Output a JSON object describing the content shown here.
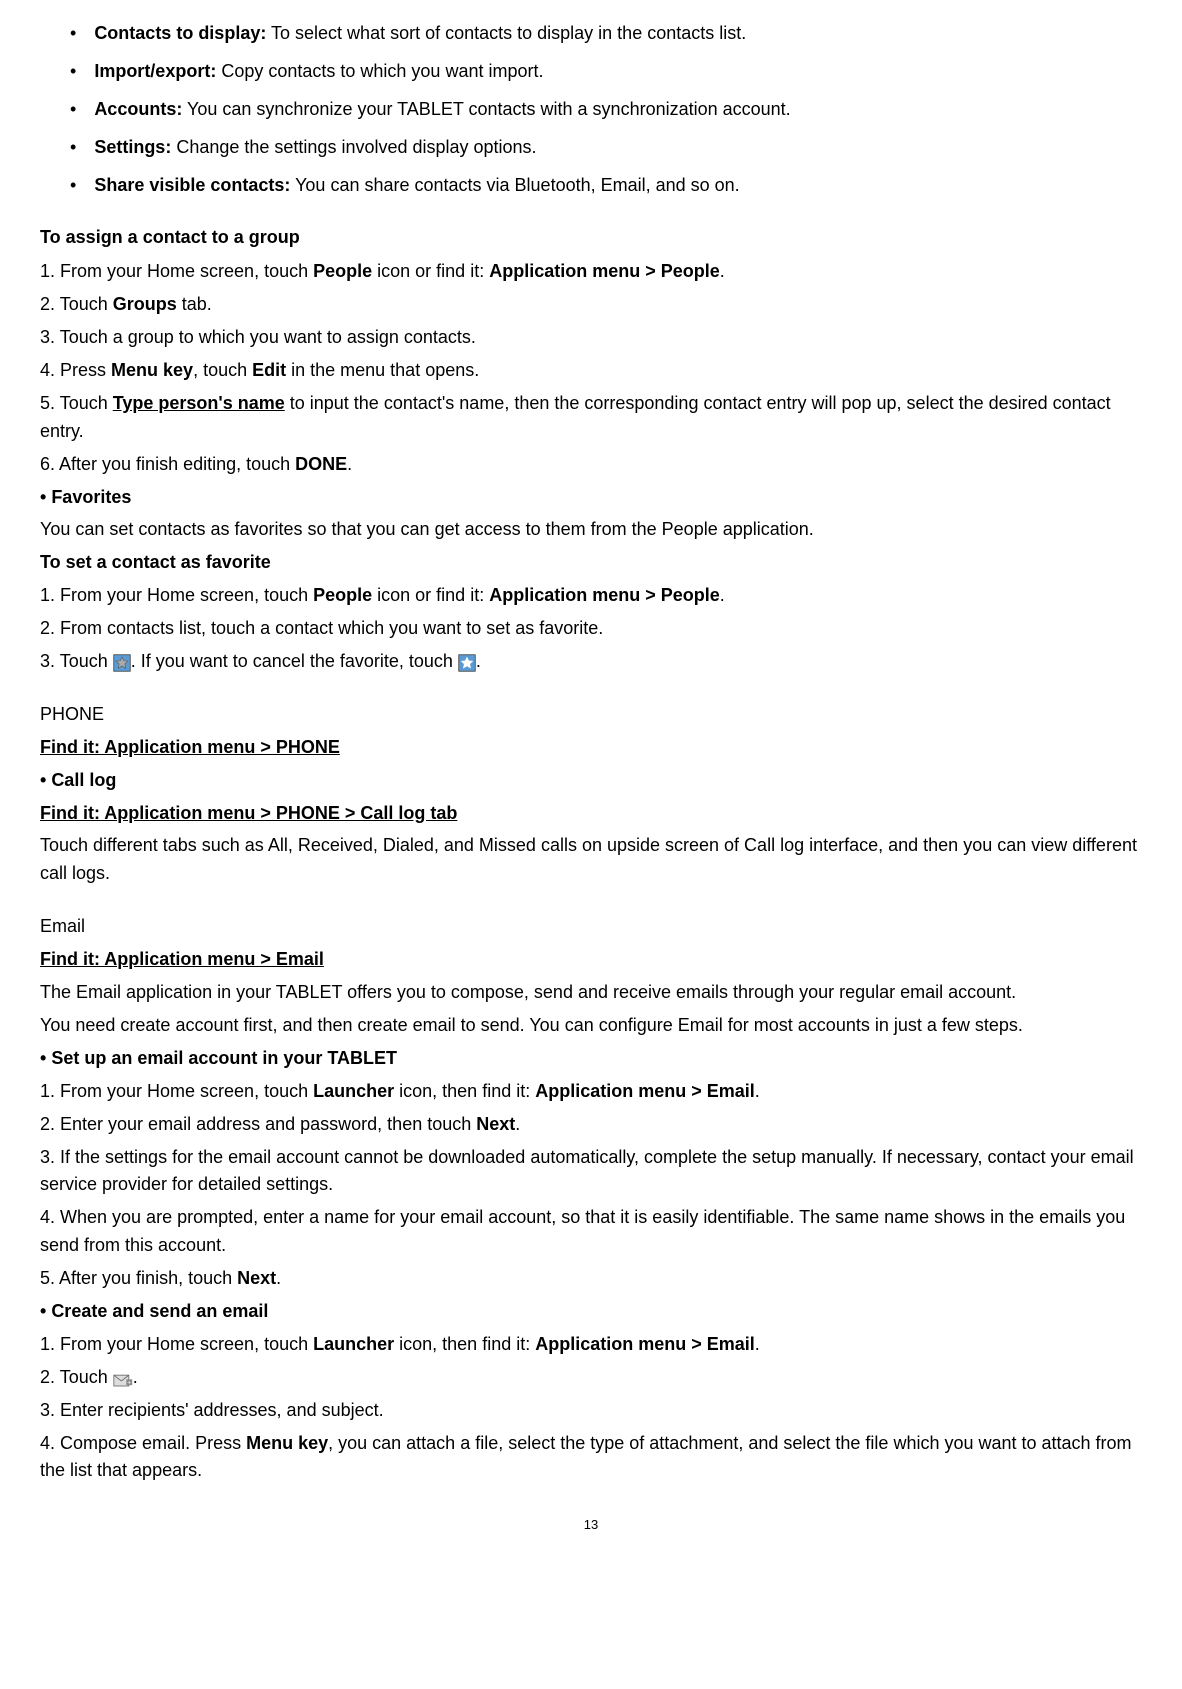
{
  "bullets": [
    {
      "label": "Contacts to display:",
      "text": " To select what sort of contacts to display in the contacts list."
    },
    {
      "label": "Import/export:",
      "text": " Copy contacts to which you want import."
    },
    {
      "label": "Accounts:",
      "text": " You can synchronize your TABLET contacts with a synchronization account."
    },
    {
      "label": "Settings:",
      "text": " Change the settings involved display options."
    },
    {
      "label": "Share visible contacts:",
      "text": " You can share contacts via Bluetooth, Email, and so on."
    }
  ],
  "assignGroup": {
    "heading": "To assign a contact to a group",
    "step1_a": "1. From your Home screen, touch ",
    "step1_b": "People",
    "step1_c": " icon or find it: ",
    "step1_d": "Application menu > People",
    "step1_e": ".",
    "step2_a": "2. Touch ",
    "step2_b": "Groups",
    "step2_c": " tab.",
    "step3": "3. Touch a group to which you want to assign contacts.",
    "step4_a": "4. Press ",
    "step4_b": "Menu key",
    "step4_c": ", touch ",
    "step4_d": "Edit",
    "step4_e": " in the menu that opens.",
    "step5_a": "5. Touch ",
    "step5_b": "Type person's name",
    "step5_c": " to input the contact's name, then the corresponding contact entry will pop up, select the desired contact entry.",
    "step6_a": "6. After you finish editing, touch ",
    "step6_b": "DONE",
    "step6_c": "."
  },
  "favorites": {
    "heading": "Favorites",
    "desc": "You can set contacts as favorites so that you can get access to them from the People application.",
    "subheading": "To set a contact as favorite",
    "step1_a": "1. From your Home screen, touch ",
    "step1_b": "People",
    "step1_c": " icon or find it: ",
    "step1_d": "Application menu > People",
    "step1_e": ".",
    "step2": "2. From contacts list, touch a contact which you want to set as favorite.",
    "step3_a": "3. Touch ",
    "step3_b": ". If you want to cancel the favorite, touch ",
    "step3_c": "."
  },
  "phone": {
    "heading": "PHONE",
    "findit": "Find it: Application menu > PHONE",
    "calllog": "Call log",
    "findit2": "Find it: Application menu > PHONE > Call log tab",
    "desc": "Touch different tabs such as All, Received, Dialed, and Missed calls on upside screen of Call log interface, and then you can view different call logs."
  },
  "email": {
    "heading": "Email",
    "findit": "Find it: Application menu > Email",
    "desc1": "The Email application in your TABLET offers you to compose, send and receive emails through your regular email account.",
    "desc2": "You need create account first, and then create email to send. You can configure Email for most accounts in just a few steps.",
    "setup_heading": "Set up an email account in your TABLET",
    "setup1_a": "1. From your Home screen, touch ",
    "setup1_b": "Launcher",
    "setup1_c": " icon, then find it: ",
    "setup1_d": "Application menu > Email",
    "setup1_e": ".",
    "setup2_a": "2. Enter your email address and password, then touch ",
    "setup2_b": "Next",
    "setup2_c": ".",
    "setup3": "3. If the settings for the email account cannot be downloaded automatically, complete the setup manually. If necessary, contact your email service provider for detailed settings.",
    "setup4": "4. When you are prompted, enter a name for your email account, so that it is easily identifiable. The same name shows in the emails you send from this account.",
    "setup5_a": "5. After you finish, touch ",
    "setup5_b": "Next",
    "setup5_c": ".",
    "create_heading": "Create and send an email",
    "create1_a": "1. From your Home screen, touch ",
    "create1_b": "Launcher",
    "create1_c": " icon, then find it: ",
    "create1_d": "Application menu > Email",
    "create1_e": ".",
    "create2_a": "2. Touch ",
    "create2_b": ".",
    "create3": "3. Enter recipients' addresses, and subject.",
    "create4_a": "4. Compose email. Press ",
    "create4_b": "Menu key",
    "create4_c": ", you can attach a file, select the type of attachment, and select the file which you want to attach from the list that appears."
  },
  "pageNum": "13"
}
